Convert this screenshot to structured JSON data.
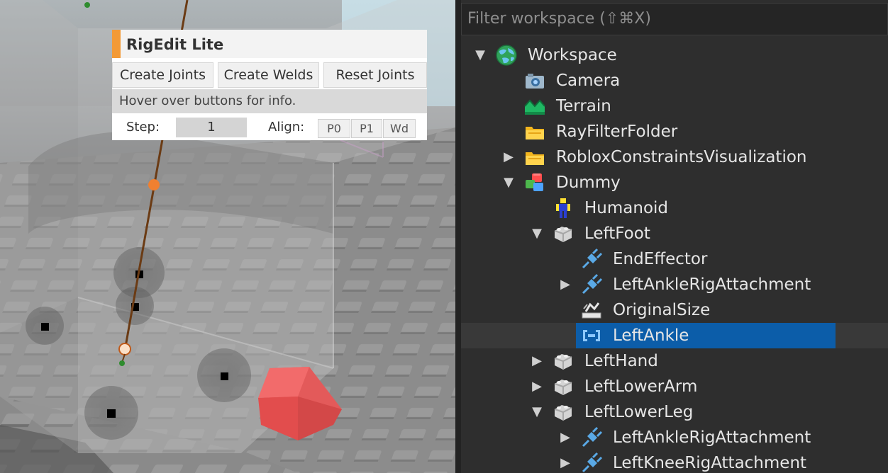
{
  "rigedit": {
    "title": "RigEdit Lite",
    "buttons": [
      "Create Joints",
      "Create Welds",
      "Reset Joints"
    ],
    "info": "Hover over buttons for info.",
    "step_label": "Step:",
    "step_value": "1",
    "align_label": "Align:",
    "align_buttons": [
      "P0",
      "P1",
      "Wd"
    ],
    "accent_color": "#f39a36"
  },
  "explorer": {
    "filter_placeholder": "Filter workspace (⇧⌘X)",
    "selection_color": "#0c5da9",
    "items": [
      {
        "label": "Workspace",
        "icon": "globe-icon",
        "depth": 0,
        "arrow": "expanded"
      },
      {
        "label": "Camera",
        "icon": "camera-icon",
        "depth": 1,
        "arrow": "none"
      },
      {
        "label": "Terrain",
        "icon": "terrain-icon",
        "depth": 1,
        "arrow": "none"
      },
      {
        "label": "RayFilterFolder",
        "icon": "folder-icon",
        "depth": 1,
        "arrow": "none"
      },
      {
        "label": "RobloxConstraintsVisualization",
        "icon": "folder-icon",
        "depth": 1,
        "arrow": "collapsed"
      },
      {
        "label": "Dummy",
        "icon": "model-icon",
        "depth": 1,
        "arrow": "expanded"
      },
      {
        "label": "Humanoid",
        "icon": "humanoid-icon",
        "depth": 2,
        "arrow": "none"
      },
      {
        "label": "LeftFoot",
        "icon": "meshpart-icon",
        "depth": 2,
        "arrow": "expanded"
      },
      {
        "label": "EndEffector",
        "icon": "attachment-icon",
        "depth": 3,
        "arrow": "none"
      },
      {
        "label": "LeftAnkleRigAttachment",
        "icon": "attachment-icon",
        "depth": 3,
        "arrow": "collapsed"
      },
      {
        "label": "OriginalSize",
        "icon": "value-icon",
        "depth": 3,
        "arrow": "none"
      },
      {
        "label": "LeftAnkle",
        "icon": "motor-icon",
        "depth": 3,
        "arrow": "none",
        "selected": true
      },
      {
        "label": "LeftHand",
        "icon": "meshpart-icon",
        "depth": 2,
        "arrow": "collapsed"
      },
      {
        "label": "LeftLowerArm",
        "icon": "meshpart-icon",
        "depth": 2,
        "arrow": "collapsed"
      },
      {
        "label": "LeftLowerLeg",
        "icon": "meshpart-icon",
        "depth": 2,
        "arrow": "expanded"
      },
      {
        "label": "LeftAnkleRigAttachment",
        "icon": "attachment-icon",
        "depth": 3,
        "arrow": "collapsed"
      },
      {
        "label": "LeftKneeRigAttachment",
        "icon": "attachment-icon",
        "depth": 3,
        "arrow": "collapsed"
      }
    ]
  }
}
